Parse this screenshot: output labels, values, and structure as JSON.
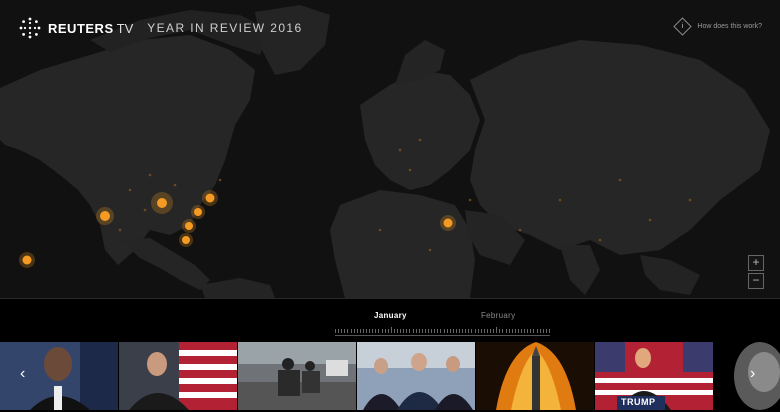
{
  "header": {
    "brand": "REUTERS",
    "brand_suffix": "TV",
    "title": "YEAR IN REVIEW 2016",
    "help_label": "How does this work?",
    "help_symbol": "i"
  },
  "map": {
    "hotspots_color": "#f59a23",
    "land_color": "#262626",
    "ocean_color": "#111111"
  },
  "zoom": {
    "in_label": "+",
    "out_label": "−"
  },
  "timeline": {
    "months": [
      {
        "label": "January",
        "active": true
      },
      {
        "label": "February",
        "active": false
      }
    ]
  },
  "thumbnails": [
    {
      "subject": "obama-portrait"
    },
    {
      "subject": "rubio-speech"
    },
    {
      "subject": "motorcade-street"
    },
    {
      "subject": "campaign-stage"
    },
    {
      "subject": "rocket-launch"
    },
    {
      "subject": "trump-rally",
      "sign_text": "TRUMP"
    }
  ],
  "nav": {
    "prev_symbol": "‹",
    "next_symbol": "›"
  }
}
